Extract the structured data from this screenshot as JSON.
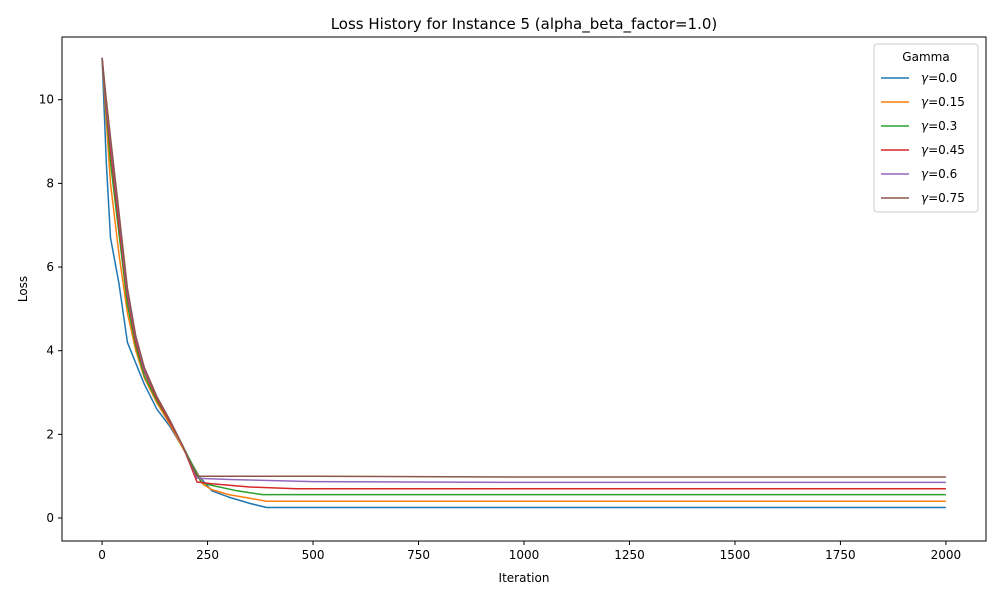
{
  "chart_data": {
    "type": "line",
    "title": "Loss History for Instance 5 (alpha_beta_factor=1.0)",
    "xlabel": "Iteration",
    "ylabel": "Loss",
    "xlim": [
      -95,
      2095
    ],
    "ylim": [
      -0.55,
      11.5
    ],
    "xticks": [
      0,
      250,
      500,
      750,
      1000,
      1250,
      1500,
      1750,
      2000
    ],
    "xtick_labels": [
      "0",
      "250",
      "500",
      "750",
      "1000",
      "1250",
      "1500",
      "1750",
      "2000"
    ],
    "yticks": [
      0,
      2,
      4,
      6,
      8,
      10
    ],
    "ytick_labels": [
      "0",
      "2",
      "4",
      "6",
      "8",
      "10"
    ],
    "grid": false,
    "legend": {
      "title": "Gamma",
      "placement": "top-right"
    },
    "series": [
      {
        "name": "γ=0.0",
        "label_prefix": "γ",
        "label_value": "=0.0",
        "color": "#1f77b4",
        "points": [
          [
            0,
            11.0
          ],
          [
            10,
            8.5
          ],
          [
            20,
            6.7
          ],
          [
            40,
            5.6
          ],
          [
            60,
            4.2
          ],
          [
            80,
            3.7
          ],
          [
            100,
            3.2
          ],
          [
            130,
            2.6
          ],
          [
            160,
            2.2
          ],
          [
            190,
            1.7
          ],
          [
            230,
            1.0
          ],
          [
            260,
            0.65
          ],
          [
            300,
            0.5
          ],
          [
            350,
            0.35
          ],
          [
            390,
            0.25
          ],
          [
            500,
            0.25
          ],
          [
            1000,
            0.25
          ],
          [
            1500,
            0.25
          ],
          [
            2000,
            0.25
          ]
        ]
      },
      {
        "name": "γ=0.15",
        "label_prefix": "γ",
        "label_value": "=0.15",
        "color": "#ff7f0e",
        "points": [
          [
            0,
            11.0
          ],
          [
            10,
            9.5
          ],
          [
            20,
            8.0
          ],
          [
            40,
            6.3
          ],
          [
            60,
            4.9
          ],
          [
            80,
            4.0
          ],
          [
            100,
            3.35
          ],
          [
            130,
            2.75
          ],
          [
            160,
            2.25
          ],
          [
            190,
            1.7
          ],
          [
            215,
            1.25
          ],
          [
            240,
            0.8
          ],
          [
            260,
            0.68
          ],
          [
            300,
            0.56
          ],
          [
            350,
            0.47
          ],
          [
            390,
            0.4
          ],
          [
            500,
            0.4
          ],
          [
            1000,
            0.4
          ],
          [
            1500,
            0.4
          ],
          [
            2000,
            0.4
          ]
        ]
      },
      {
        "name": "γ=0.3",
        "label_prefix": "γ",
        "label_value": "=0.3",
        "color": "#2ca02c",
        "points": [
          [
            0,
            11.0
          ],
          [
            10,
            9.7
          ],
          [
            20,
            8.5
          ],
          [
            40,
            6.8
          ],
          [
            60,
            5.1
          ],
          [
            80,
            4.1
          ],
          [
            100,
            3.4
          ],
          [
            130,
            2.8
          ],
          [
            160,
            2.3
          ],
          [
            190,
            1.75
          ],
          [
            215,
            1.25
          ],
          [
            235,
            0.85
          ],
          [
            260,
            0.78
          ],
          [
            320,
            0.65
          ],
          [
            380,
            0.56
          ],
          [
            500,
            0.56
          ],
          [
            1000,
            0.56
          ],
          [
            1500,
            0.56
          ],
          [
            2000,
            0.56
          ]
        ]
      },
      {
        "name": "γ=0.45",
        "label_prefix": "γ",
        "label_value": "=0.45",
        "color": "#d62728",
        "points": [
          [
            0,
            11.0
          ],
          [
            10,
            9.8
          ],
          [
            20,
            8.8
          ],
          [
            40,
            7.0
          ],
          [
            60,
            5.3
          ],
          [
            80,
            4.2
          ],
          [
            100,
            3.5
          ],
          [
            130,
            2.85
          ],
          [
            160,
            2.3
          ],
          [
            190,
            1.75
          ],
          [
            210,
            1.25
          ],
          [
            225,
            0.86
          ],
          [
            260,
            0.82
          ],
          [
            350,
            0.74
          ],
          [
            460,
            0.7
          ],
          [
            1000,
            0.7
          ],
          [
            1500,
            0.7
          ],
          [
            2000,
            0.7
          ]
        ]
      },
      {
        "name": "γ=0.6",
        "label_prefix": "γ",
        "label_value": "=0.6",
        "color": "#9467bd",
        "points": [
          [
            0,
            11.0
          ],
          [
            10,
            9.9
          ],
          [
            20,
            9.0
          ],
          [
            40,
            7.2
          ],
          [
            60,
            5.4
          ],
          [
            80,
            4.3
          ],
          [
            100,
            3.55
          ],
          [
            130,
            2.9
          ],
          [
            160,
            2.35
          ],
          [
            190,
            1.75
          ],
          [
            210,
            1.3
          ],
          [
            225,
            0.95
          ],
          [
            300,
            0.92
          ],
          [
            500,
            0.87
          ],
          [
            1000,
            0.85
          ],
          [
            1500,
            0.85
          ],
          [
            2000,
            0.85
          ]
        ]
      },
      {
        "name": "γ=0.75",
        "label_prefix": "γ",
        "label_value": "=0.75",
        "color": "#8c564b",
        "points": [
          [
            0,
            11.0
          ],
          [
            10,
            10.0
          ],
          [
            20,
            9.1
          ],
          [
            40,
            7.3
          ],
          [
            60,
            5.5
          ],
          [
            80,
            4.35
          ],
          [
            100,
            3.6
          ],
          [
            130,
            2.9
          ],
          [
            160,
            2.35
          ],
          [
            190,
            1.75
          ],
          [
            210,
            1.3
          ],
          [
            225,
            1.0
          ],
          [
            300,
            1.0
          ],
          [
            500,
            1.0
          ],
          [
            1000,
            0.98
          ],
          [
            1500,
            0.98
          ],
          [
            2000,
            0.98
          ]
        ]
      }
    ]
  }
}
